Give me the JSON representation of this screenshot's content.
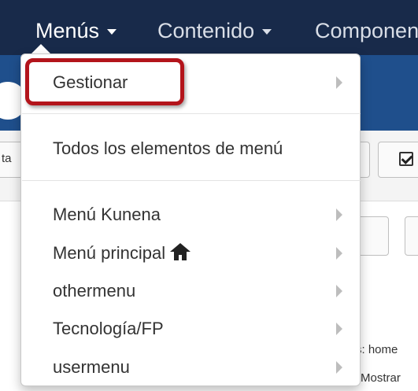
{
  "navbar": {
    "items": [
      {
        "label": "Menús",
        "active": true
      },
      {
        "label": "Contenido",
        "active": false
      },
      {
        "label": "Componen",
        "active": false
      }
    ]
  },
  "background": {
    "toolbar_fragment": "ta",
    "footer_line_1": "s: home",
    "footer_line_2": "Mostrar"
  },
  "menu_dropdown": {
    "highlighted_item": "Gestionar",
    "sections": [
      {
        "items": [
          {
            "label": "Gestionar",
            "has_submenu": true
          }
        ]
      },
      {
        "items": [
          {
            "label": "Todos los elementos de menú",
            "has_submenu": false
          }
        ]
      },
      {
        "items": [
          {
            "label": "Menú Kunena",
            "has_submenu": true
          },
          {
            "label": "Menú principal",
            "has_submenu": true,
            "icon": "home-icon"
          },
          {
            "label": "othermenu",
            "has_submenu": true
          },
          {
            "label": "Tecnología/FP",
            "has_submenu": true
          },
          {
            "label": "usermenu",
            "has_submenu": true
          }
        ]
      }
    ]
  },
  "colors": {
    "navbar_bg": "#182a4a",
    "subheader_bg": "#1f4f8c",
    "highlight_border": "#b3141b"
  }
}
